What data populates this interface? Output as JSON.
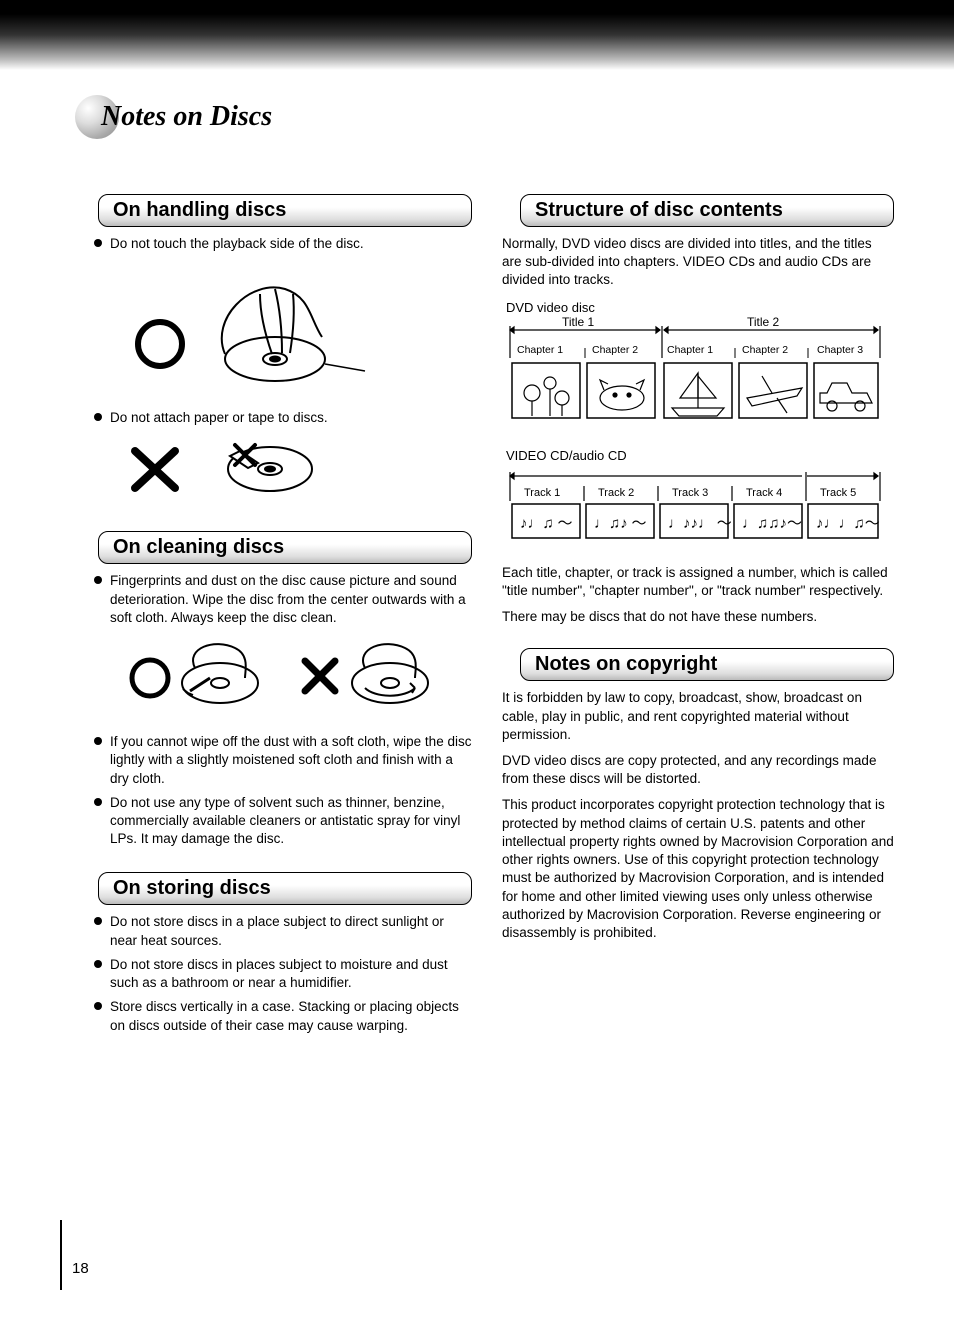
{
  "pageTitle": "Notes on Discs",
  "pageNumber": "18",
  "left": {
    "handling": {
      "heading": "On handling discs",
      "item1": "Do not touch the playback side of the disc.",
      "item2": "Do not attach paper or tape to discs."
    },
    "cleaning": {
      "heading": "On cleaning discs",
      "item1": "Fingerprints and dust on the disc cause picture and sound deterioration. Wipe the disc from the center outwards with a soft cloth. Always keep the disc clean.",
      "item2": "If you cannot wipe off the dust with a soft cloth, wipe the disc lightly with a slightly moistened soft cloth and finish with a dry cloth.",
      "item3": "Do not use any type of solvent such as thinner, benzine, commercially available cleaners or antistatic spray for vinyl LPs. It may damage the disc."
    },
    "storing": {
      "heading": "On storing discs",
      "item1": "Do not store discs in a place subject to direct sunlight or near heat sources.",
      "item2": "Do not store discs in places subject to moisture and dust such as a bathroom or near a humidifier.",
      "item3": "Store discs vertically in a case. Stacking or placing objects on discs outside of their case may cause warping."
    }
  },
  "right": {
    "structure": {
      "heading": "Structure of disc contents",
      "p1": "Normally, DVD video discs are divided into titles, and the titles are sub-divided into chapters. VIDEO CDs and audio CDs are divided into tracks.",
      "dvd": {
        "label": "DVD video disc",
        "title1": "Title 1",
        "title2": "Title 2",
        "ch1": "Chapter 1",
        "ch2": "Chapter 2",
        "ch3": "Chapter 1",
        "ch4": "Chapter 2",
        "ch5": "Chapter 3"
      },
      "cd": {
        "label": "VIDEO CD/audio CD",
        "track1": "Track 1",
        "track2": "Track 2",
        "track3": "Track 3",
        "track4": "Track 4",
        "track5": "Track 5"
      },
      "p2": "Each title, chapter, or track is assigned a number, which is called \"title number\", \"chapter number\", or \"track number\" respectively.",
      "p3": "There may be discs that do not have these numbers."
    },
    "copyright": {
      "heading": "Notes on copyright",
      "p1": "It is forbidden by law to copy, broadcast, show, broadcast on cable, play in public, and rent copyrighted material without permission.",
      "p2": "DVD video discs are copy protected, and any recordings made from these discs will be distorted.",
      "p3": "This product incorporates copyright protection technology that is protected by method claims of certain U.S. patents and other intellectual property rights owned by Macrovision Corporation and other rights owners. Use of this copyright protection technology must be authorized by Macrovision Corporation, and is intended for home and other limited viewing uses only unless otherwise authorized by Macrovision Corporation. Reverse engineering or disassembly is prohibited."
    }
  }
}
